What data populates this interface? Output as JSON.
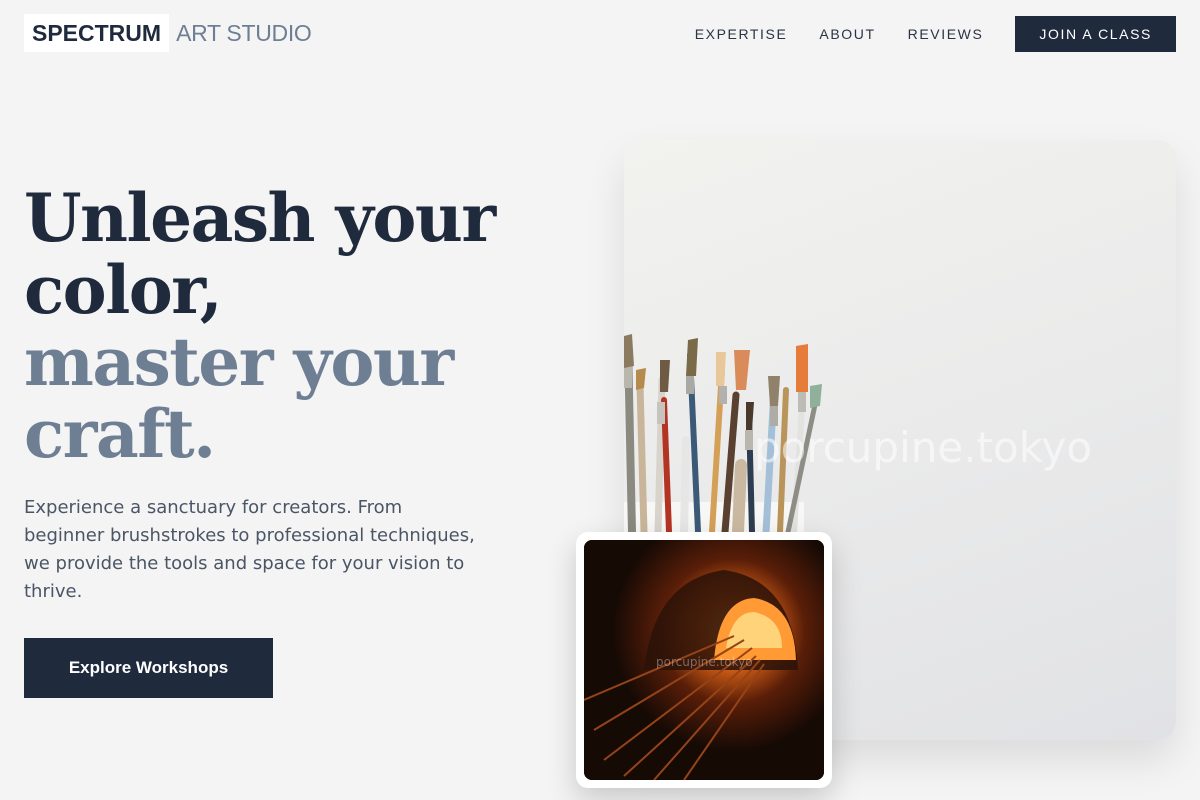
{
  "brand": {
    "name": "SPECTRUM",
    "suffix": "ART STUDIO"
  },
  "nav": {
    "links": [
      "EXPERTISE",
      "ABOUT",
      "REVIEWS"
    ],
    "cta": "JOIN A CLASS"
  },
  "hero": {
    "title_line_1": "Unleash your",
    "title_line_2": "color,",
    "title_line_3": "master your",
    "title_line_4": "craft.",
    "description": "Experience a sanctuary for creators. From beginner brushstrokes to professional techniques, we provide the tools and space for your vision to thrive.",
    "button": "Explore Workshops"
  },
  "images": {
    "main_watermark": "porcupine.tokyo",
    "small_watermark": "porcupine.tokyo"
  },
  "colors": {
    "primary": "#1f2a3d",
    "accent": "#6e7f94",
    "background": "#f4f4f4"
  }
}
